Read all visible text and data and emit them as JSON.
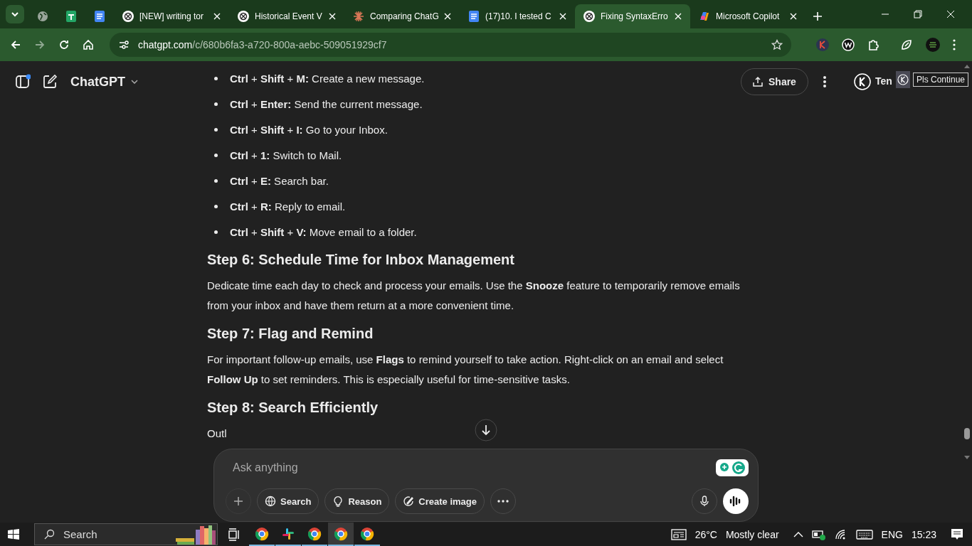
{
  "tabs": [
    {
      "kind": "globe",
      "selected": false
    },
    {
      "kind": "sheets",
      "selected": false
    },
    {
      "kind": "docs",
      "selected": false
    },
    {
      "kind": "openai",
      "title": "[NEW] writing tor",
      "selected": false
    },
    {
      "kind": "openai",
      "title": "Historical Event V",
      "selected": false
    },
    {
      "kind": "burst",
      "title": "Comparing ChatG",
      "selected": false
    },
    {
      "kind": "docs",
      "title": "(17)10. I tested C",
      "selected": false
    },
    {
      "kind": "openai",
      "title": "Fixing SyntaxErro",
      "selected": true
    },
    {
      "kind": "copilot",
      "title": "Microsoft Copilot",
      "selected": false
    }
  ],
  "address": {
    "host": "chatgpt.com",
    "path": "/c/680b6fa3-a720-800a-aebc-509051929cf7"
  },
  "header": {
    "app_name": "ChatGPT",
    "share": "Share",
    "user": "Ten",
    "tooltip": "Pls Continue"
  },
  "content": [
    {
      "kind": "bullet",
      "text": "**Ctrl** + **Shift** + **M:** Create a new message."
    },
    {
      "kind": "bullet",
      "text": "**Ctrl** + **Enter:** Send the current message."
    },
    {
      "kind": "bullet",
      "text": "**Ctrl** + **Shift** + **I:** Go to your Inbox."
    },
    {
      "kind": "bullet",
      "text": "**Ctrl** + **1:** Switch to Mail."
    },
    {
      "kind": "bullet",
      "text": "**Ctrl** + **E:** Search bar."
    },
    {
      "kind": "bullet",
      "text": "**Ctrl** + **R:** Reply to email."
    },
    {
      "kind": "bullet",
      "text": "**Ctrl** + **Shift** + **V:** Move email to a folder."
    },
    {
      "kind": "heading",
      "text": "Step 6: Schedule Time for Inbox Management"
    },
    {
      "kind": "paragraph",
      "text": "Dedicate time each day to check and process your emails. Use the **Snooze** feature to temporarily remove emails from your inbox and have them return at a more convenient time."
    },
    {
      "kind": "heading",
      "text": "Step 7: Flag and Remind"
    },
    {
      "kind": "paragraph",
      "text": "For important follow-up emails, use **Flags** to remind yourself to take action. Right-click on an email and select **Follow Up** to set reminders. This is especially useful for time-sensitive tasks."
    },
    {
      "kind": "heading",
      "text": "Step 8: Search Efficiently"
    },
    {
      "kind": "paragraph",
      "text": "Outl"
    }
  ],
  "composer": {
    "placeholder": "Ask anything",
    "tools": [
      {
        "kind": "globe",
        "label": "Search"
      },
      {
        "kind": "bulb",
        "label": "Reason"
      },
      {
        "kind": "brush",
        "label": "Create image"
      }
    ]
  },
  "taskbar": {
    "search": "Search",
    "apps": [
      {
        "kind": "chrome",
        "selected": false
      },
      {
        "kind": "slack",
        "selected": false
      },
      {
        "kind": "chrome",
        "selected": false
      },
      {
        "kind": "chrome",
        "selected": true
      },
      {
        "kind": "chrome",
        "selected": false
      }
    ],
    "temperature": "26°C",
    "weather": "Mostly clear",
    "language": "ENG",
    "time": "15:23"
  }
}
